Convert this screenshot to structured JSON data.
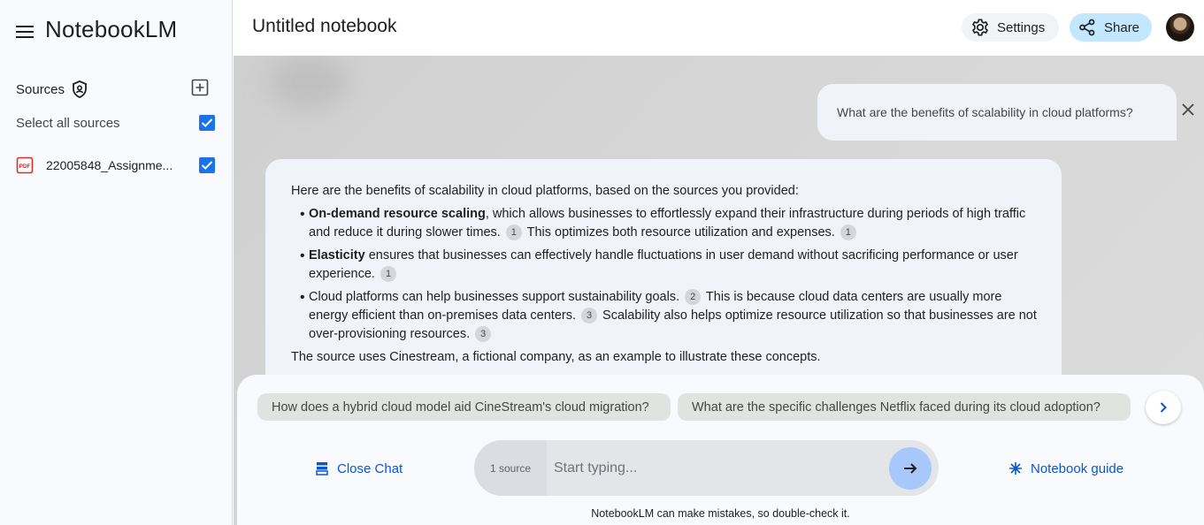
{
  "app": {
    "name": "NotebookLM"
  },
  "sidebar": {
    "sources_label": "Sources",
    "select_all_label": "Select all sources",
    "items": [
      {
        "name": "22005848_Assignme...",
        "checked": true
      }
    ],
    "select_all_checked": true
  },
  "header": {
    "title": "Untitled notebook",
    "settings_label": "Settings",
    "share_label": "Share"
  },
  "chat": {
    "user_question": "What are the benefits of scalability in cloud platforms?",
    "answer": {
      "intro": "Here are the benefits of scalability in cloud platforms, based on the sources you provided:",
      "bullets": [
        {
          "bold": "On-demand resource scaling",
          "text_a": ", which allows businesses to effortlessly expand their infrastructure during periods of high traffic and reduce it during slower times.",
          "cite_a": "1",
          "text_b": " This optimizes both resource utilization and expenses.",
          "cite_b": "1"
        },
        {
          "bold": "Elasticity",
          "text_a": " ensures that businesses can effectively handle fluctuations in user demand without sacrificing performance or user experience.",
          "cite_a": "1"
        },
        {
          "text_a": "Cloud platforms can help businesses support sustainability goals.",
          "cite_a": "2",
          "text_b": " This is because cloud data centers are usually more energy efficient than on-premises data centers.",
          "cite_b": "3",
          "text_c": " Scalability also helps optimize resource utilization so that businesses are not over-provisioning resources.",
          "cite_c": "3"
        }
      ],
      "outro": "The source uses Cinestream, a fictional company, as an example to illustrate these concepts."
    }
  },
  "bottom": {
    "suggestions": [
      "How does a hybrid cloud model aid CineStream's cloud migration?",
      "What are the specific challenges Netflix faced during its cloud adoption?"
    ],
    "close_chat_label": "Close Chat",
    "source_count": "1 source",
    "input_placeholder": "Start typing...",
    "notebook_guide_label": "Notebook guide",
    "disclaimer": "NotebookLM can make mistakes, so double-check it."
  },
  "colors": {
    "accent": "#0b57d0",
    "checkbox": "#1a73e8",
    "share_bg": "#c2e7ff",
    "send_bg": "#a8c7fa",
    "pdf_red": "#d93025"
  },
  "icons": [
    "menu-icon",
    "shield-icon",
    "add-box-icon",
    "checkbox-checked-icon",
    "pdf-icon",
    "gear-icon",
    "share-icon",
    "close-icon",
    "chevron-right-icon",
    "chat-close-icon",
    "arrow-right-icon",
    "sparkle-icon"
  ]
}
